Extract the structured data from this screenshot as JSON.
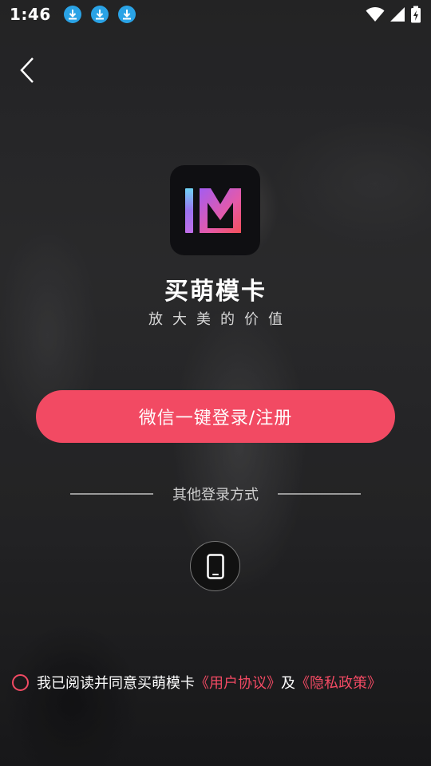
{
  "status_bar": {
    "time": "1:46",
    "left_icons": [
      "download-icon",
      "download-icon",
      "download-icon"
    ],
    "right_icons": [
      "wifi-icon",
      "signal-icon",
      "battery-charging-icon"
    ]
  },
  "app": {
    "name": "买萌模卡",
    "slogan": "放大美的价值"
  },
  "buttons": {
    "wechat_login": "微信一键登录/注册"
  },
  "other_login": {
    "label": "其他登录方式"
  },
  "agreement": {
    "prefix": "我已阅读并同意买萌模卡",
    "user_agreement": "《用户协议》",
    "joiner": "及",
    "privacy_policy": "《隐私政策》"
  },
  "colors": {
    "accent": "#f24a63",
    "download_badge": "#2aa3e6"
  }
}
